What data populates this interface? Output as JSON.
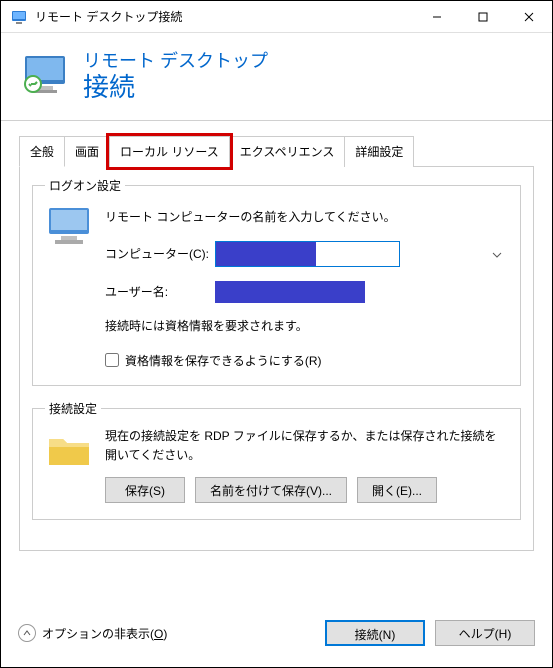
{
  "titlebar": {
    "title": "リモート デスクトップ接続"
  },
  "header": {
    "line1": "リモート デスクトップ",
    "line2": "接続"
  },
  "tabs": {
    "general": "全般",
    "display": "画面",
    "localres": "ローカル リソース",
    "experience": "エクスペリエンス",
    "advanced": "詳細設定"
  },
  "logon": {
    "legend": "ログオン設定",
    "instruction": "リモート コンピューターの名前を入力してください。",
    "computer_label": "コンピューター(C):",
    "username_label": "ユーザー名:",
    "note": "接続時には資格情報を要求されます。",
    "allow_save": "資格情報を保存できるようにする(R)"
  },
  "conn": {
    "legend": "接続設定",
    "text": "現在の接続設定を RDP ファイルに保存するか、または保存された接続を開いてください。",
    "save": "保存(S)",
    "save_as": "名前を付けて保存(V)...",
    "open": "開く(E)..."
  },
  "footer": {
    "options": "オプションの非表示(",
    "options_hotkey": "O",
    "options_suffix": ")",
    "connect": "接続(N)",
    "help": "ヘルプ(H)"
  }
}
